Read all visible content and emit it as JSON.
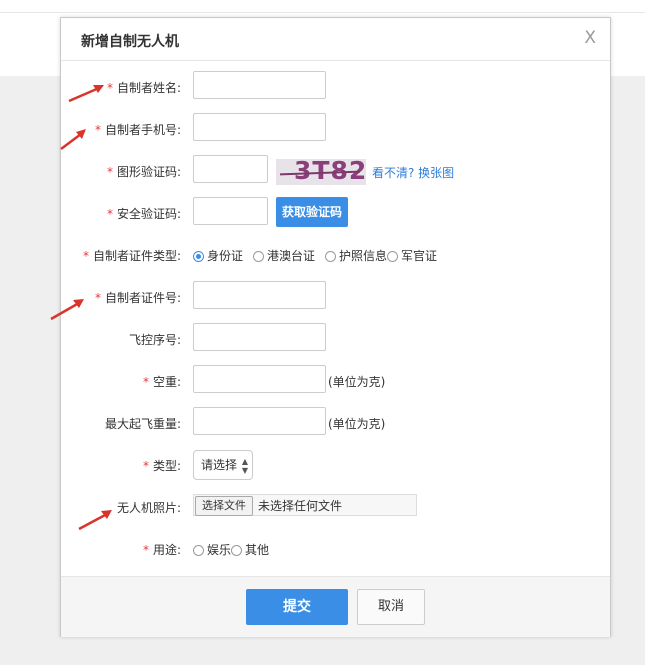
{
  "dialog": {
    "title": "新增自制无人机",
    "close": "X"
  },
  "form": {
    "name_label": "自制者姓名:",
    "phone_label": "自制者手机号:",
    "captcha_label": "图形验证码:",
    "captcha_image_text": "3T82",
    "captcha_refresh": "看不清? 换张图",
    "sms_label": "安全验证码:",
    "sms_button": "获取验证码",
    "id_type_label": "自制者证件类型:",
    "id_types": [
      "身份证",
      "港澳台证",
      "护照信息",
      "军官证"
    ],
    "id_type_selected": "身份证",
    "id_number_label": "自制者证件号:",
    "serial_label": "飞控序号:",
    "empty_weight_label": "空重:",
    "empty_weight_unit": "(单位为克)",
    "max_takeoff_label": "最大起飞重量:",
    "max_takeoff_unit": "(单位为克)",
    "type_label": "类型:",
    "type_selected": "请选择",
    "photo_label": "无人机照片:",
    "photo_button": "选择文件",
    "photo_status": "未选择任何文件",
    "usage_label": "用途:",
    "usage_options": [
      "娱乐",
      "其他"
    ]
  },
  "footer": {
    "submit": "提交",
    "cancel": "取消"
  },
  "colors": {
    "primary": "#3a8ee6",
    "required": "#e4393c",
    "annotation_arrow": "#d9342b",
    "link": "#2f7ed8"
  }
}
